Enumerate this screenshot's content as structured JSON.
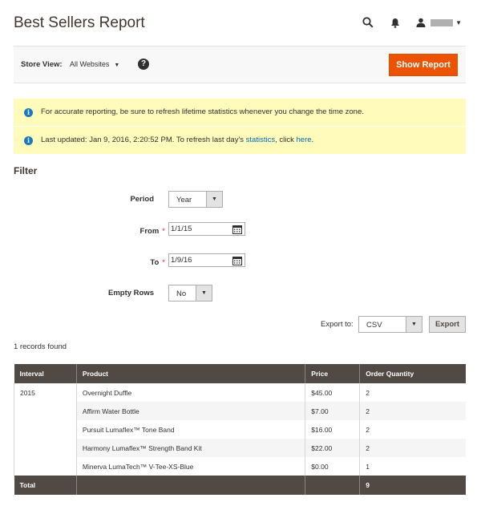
{
  "header": {
    "title": "Best Sellers Report",
    "search_icon": "search-icon",
    "notification_icon": "bell-icon",
    "user_icon": "user-icon"
  },
  "store_bar": {
    "label": "Store View:",
    "selected": "All Websites",
    "help": "?",
    "show_report": "Show Report"
  },
  "notices": {
    "refresh_msg": "For accurate reporting, be sure to refresh lifetime statistics whenever you change the time zone.",
    "updated_prefix": "Last updated: Jan 9, 2016, 2:20:52 PM. To refresh last day's ",
    "updated_link1": "statistics",
    "updated_middle": ", click ",
    "updated_link2": "here",
    "updated_suffix": "."
  },
  "filter": {
    "title": "Filter",
    "period_label": "Period",
    "period_value": "Year",
    "from_label": "From",
    "from_value": "1/1/15",
    "to_label": "To",
    "to_value": "1/9/16",
    "empty_rows_label": "Empty Rows",
    "empty_rows_value": "No",
    "required_mark": "*"
  },
  "export": {
    "label": "Export to:",
    "format": "CSV",
    "button": "Export"
  },
  "records_found": "1 records found",
  "table": {
    "headers": [
      "Interval",
      "Product",
      "Price",
      "Order Quantity"
    ],
    "interval": "2015",
    "rows": [
      {
        "product": "Overnight Duffle",
        "price": "$45.00",
        "qty": "2"
      },
      {
        "product": "Affirm Water Bottle",
        "price": "$7.00",
        "qty": "2"
      },
      {
        "product": "Pursuit Lumaflex™ Tone Band",
        "price": "$16.00",
        "qty": "2"
      },
      {
        "product": "Harmony Lumaflex™ Strength Band Kit",
        "price": "$22.00",
        "qty": "2"
      },
      {
        "product": "Minerva LumaTech™ V-Tee-XS-Blue",
        "price": "$0.00",
        "qty": "1"
      }
    ],
    "total_label": "Total",
    "total_qty": "9"
  },
  "colors": {
    "accent": "#eb5202",
    "table_header": "#514943",
    "notice_bg": "#fffbbb",
    "link": "#006bb4"
  }
}
